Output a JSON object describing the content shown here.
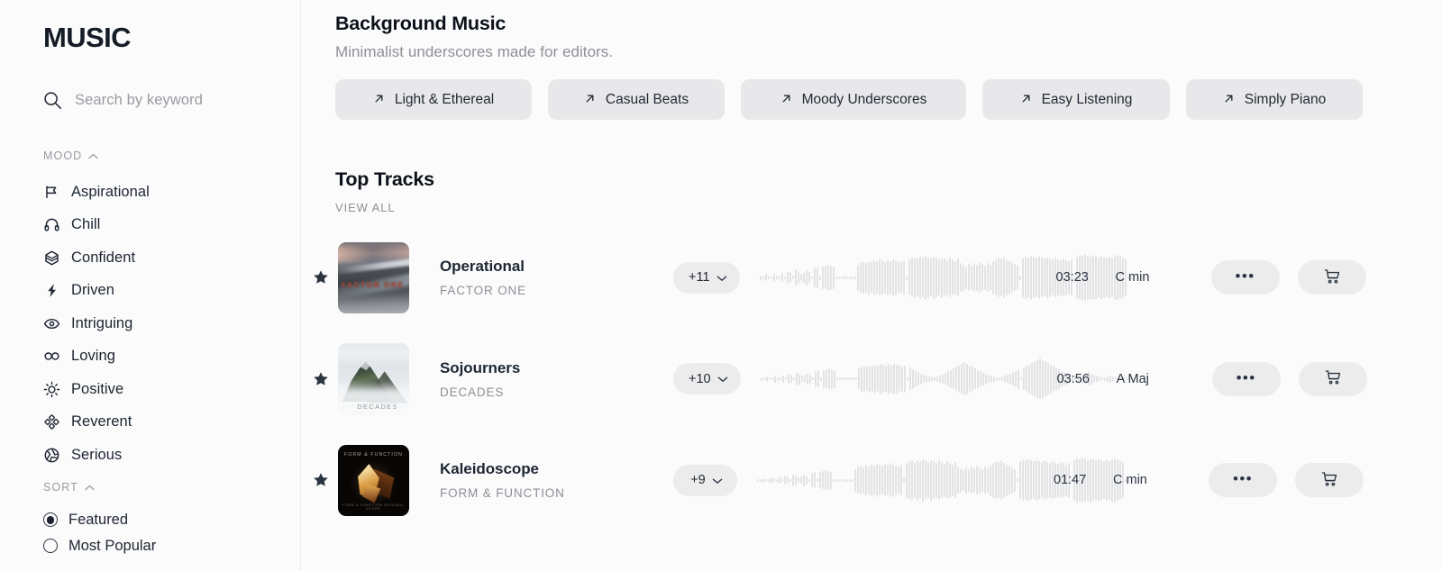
{
  "brand": "MUSIC",
  "search": {
    "placeholder": "Search by keyword",
    "icon": "search-icon"
  },
  "sidebar": {
    "mood_group": {
      "label": "MOOD",
      "caret": "chevron-up-icon"
    },
    "moods": [
      {
        "label": "Aspirational",
        "icon": "flag-icon"
      },
      {
        "label": "Chill",
        "icon": "headphones-icon"
      },
      {
        "label": "Confident",
        "icon": "hexagon-layers-icon"
      },
      {
        "label": "Driven",
        "icon": "lightning-bolt-icon"
      },
      {
        "label": "Intriguing",
        "icon": "eye-icon"
      },
      {
        "label": "Loving",
        "icon": "infinity-icon"
      },
      {
        "label": "Positive",
        "icon": "sun-icon"
      },
      {
        "label": "Reverent",
        "icon": "clover-icon"
      },
      {
        "label": "Serious",
        "icon": "aperture-icon"
      }
    ],
    "sort_group": {
      "label": "SORT",
      "caret": "chevron-up-icon"
    },
    "sort_options": [
      {
        "label": "Featured",
        "selected": true
      },
      {
        "label": "Most Popular",
        "selected": false
      }
    ]
  },
  "header": {
    "title": "Background Music",
    "subtitle": "Minimalist underscores made for editors.",
    "chips": [
      {
        "label": "Light & Ethereal",
        "icon": "arrow-up-right-icon"
      },
      {
        "label": "Casual Beats",
        "icon": "arrow-up-right-icon"
      },
      {
        "label": "Moody Underscores",
        "icon": "arrow-up-right-icon"
      },
      {
        "label": "Easy Listening",
        "icon": "arrow-up-right-icon"
      },
      {
        "label": "Simply Piano",
        "icon": "arrow-up-right-icon"
      }
    ]
  },
  "top_tracks": {
    "title": "Top Tracks",
    "view_all": "VIEW ALL",
    "tracks": [
      {
        "title": "Operational",
        "artist": "FACTOR ONE",
        "versions": "+11",
        "duration": "03:23",
        "key": "C min",
        "favorited": true,
        "art_text": "FACTOR ONE",
        "art_style": "road"
      },
      {
        "title": "Sojourners",
        "artist": "DECADES",
        "versions": "+10",
        "duration": "03:56",
        "key": "A Maj",
        "favorited": true,
        "art_text": "DECADES",
        "art_style": "mountain"
      },
      {
        "title": "Kaleidoscope",
        "artist": "FORM & FUNCTION",
        "versions": "+9",
        "duration": "01:47",
        "key": "C min",
        "favorited": true,
        "art_text": "FORM & FUNCTION",
        "art_text_bottom": "FORM & FUNCTION  ORIGINAL SCORE",
        "art_style": "crystal"
      }
    ],
    "row_actions": {
      "more_label": "•••",
      "cart_icon": "shopping-cart-icon",
      "chevron": "chevron-down-icon",
      "star": "star-filled-icon"
    }
  },
  "colors": {
    "page_bg": "#fbfbfc",
    "chip_bg": "#e8e8ea",
    "pill_bg": "#ececed",
    "text_dark": "#1d2530",
    "text_muted": "#8d9096",
    "waveform": "#e2e3e5",
    "divider": "#ececed"
  },
  "waveforms": [
    [
      6,
      4,
      9,
      5,
      4,
      11,
      6,
      5,
      12,
      4,
      16,
      14,
      5,
      22,
      17,
      10,
      13,
      20,
      14,
      4,
      26,
      28,
      6,
      30,
      31,
      34,
      32,
      30,
      3,
      3,
      3,
      5,
      4,
      3,
      3,
      3,
      34,
      40,
      42,
      39,
      44,
      41,
      46,
      43,
      48,
      45,
      42,
      47,
      44,
      49,
      46,
      43,
      40,
      44,
      6,
      48,
      52,
      54,
      50,
      56,
      52,
      58,
      54,
      50,
      56,
      52,
      48,
      54,
      50,
      46,
      52,
      48,
      44,
      50,
      38,
      34,
      30,
      36,
      32,
      38,
      34,
      40,
      36,
      32,
      38,
      34,
      44,
      48,
      52,
      50,
      54,
      48,
      44,
      40,
      36,
      32,
      6,
      52,
      56,
      54,
      58,
      55,
      52,
      56,
      53,
      50,
      54,
      51,
      48,
      52,
      49,
      46,
      50,
      47,
      44,
      48,
      4,
      56,
      60,
      58,
      62,
      59,
      56,
      60,
      57,
      54,
      58,
      55,
      52,
      56,
      53,
      58,
      60,
      57,
      54,
      50,
      4,
      3
    ],
    [
      5,
      3,
      7,
      4,
      3,
      9,
      5,
      4,
      10,
      3,
      13,
      11,
      4,
      18,
      14,
      8,
      11,
      16,
      12,
      3,
      21,
      23,
      5,
      24,
      25,
      27,
      26,
      24,
      3,
      3,
      3,
      4,
      3,
      3,
      3,
      3,
      28,
      33,
      35,
      32,
      36,
      34,
      38,
      35,
      40,
      37,
      34,
      39,
      36,
      41,
      38,
      35,
      33,
      36,
      5,
      30,
      26,
      22,
      18,
      14,
      11,
      9,
      7,
      6,
      5,
      7,
      9,
      12,
      16,
      20,
      24,
      28,
      32,
      36,
      40,
      44,
      40,
      36,
      32,
      28,
      24,
      20,
      17,
      14,
      11,
      9,
      7,
      5,
      4,
      6,
      8,
      11,
      14,
      18,
      22,
      26,
      4,
      30,
      34,
      38,
      42,
      46,
      50,
      54,
      50,
      46,
      42,
      38,
      34,
      30,
      26,
      22,
      18,
      14,
      10,
      8,
      3,
      6,
      9,
      12,
      15,
      18,
      14,
      11,
      8,
      6,
      4,
      5,
      7,
      9,
      6,
      4,
      3,
      3,
      3,
      3,
      3,
      3
    ],
    [
      4,
      3,
      6,
      4,
      3,
      8,
      5,
      4,
      9,
      3,
      12,
      10,
      4,
      16,
      13,
      7,
      10,
      15,
      11,
      3,
      19,
      21,
      5,
      22,
      24,
      26,
      25,
      23,
      3,
      3,
      3,
      4,
      3,
      3,
      3,
      3,
      30,
      36,
      38,
      35,
      40,
      37,
      42,
      39,
      44,
      41,
      38,
      43,
      40,
      45,
      42,
      39,
      36,
      40,
      5,
      46,
      50,
      52,
      48,
      54,
      50,
      56,
      52,
      48,
      54,
      50,
      46,
      52,
      48,
      44,
      50,
      46,
      42,
      48,
      36,
      32,
      28,
      34,
      30,
      36,
      32,
      38,
      34,
      30,
      36,
      32,
      42,
      46,
      50,
      48,
      52,
      46,
      42,
      38,
      34,
      30,
      5,
      50,
      54,
      52,
      56,
      53,
      50,
      54,
      51,
      48,
      52,
      49,
      46,
      50,
      47,
      44,
      48,
      45,
      42,
      46,
      4,
      54,
      58,
      56,
      60,
      57,
      54,
      58,
      55,
      52,
      56,
      53,
      50,
      54,
      51,
      56,
      58,
      55,
      52,
      48,
      4,
      3
    ]
  ]
}
